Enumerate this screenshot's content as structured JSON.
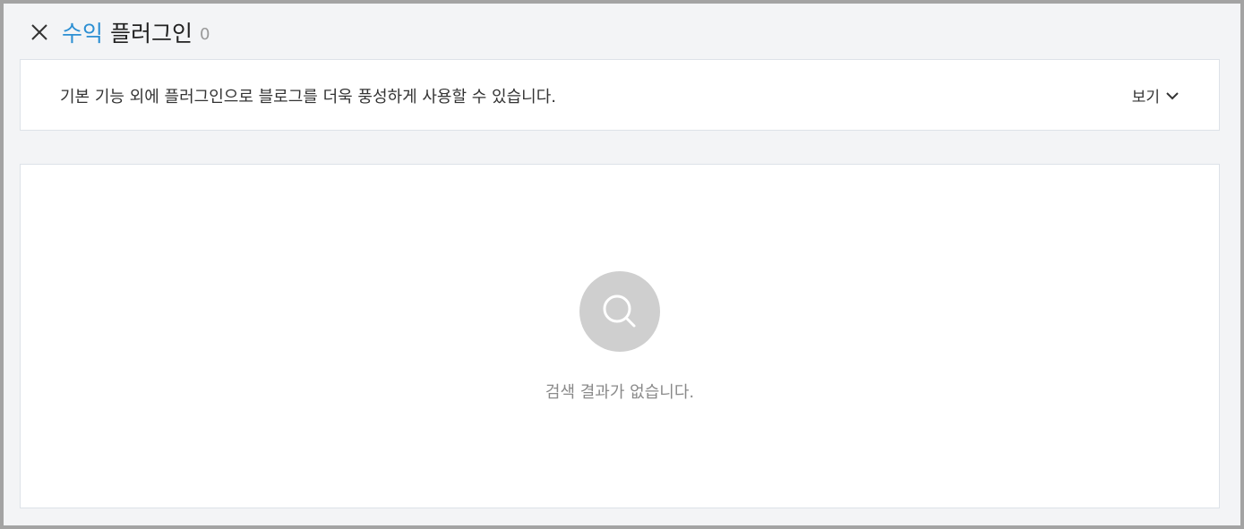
{
  "header": {
    "close_icon": "close-icon",
    "title_accent": "수익",
    "title_main": "플러그인",
    "count": "0"
  },
  "notice": {
    "text": "기본 기능 외에 플러그인으로 블로그를 더욱 풍성하게 사용할 수 있습니다.",
    "view_label": "보기",
    "view_icon": "chevron-down-icon"
  },
  "empty_state": {
    "icon": "search-icon",
    "message": "검색 결과가 없습니다."
  },
  "colors": {
    "accent": "#2c8fd3",
    "background": "#f3f4f6",
    "panel": "#ffffff",
    "empty_icon_bg": "#cfcfcf",
    "muted_text": "#8a8a8a"
  }
}
